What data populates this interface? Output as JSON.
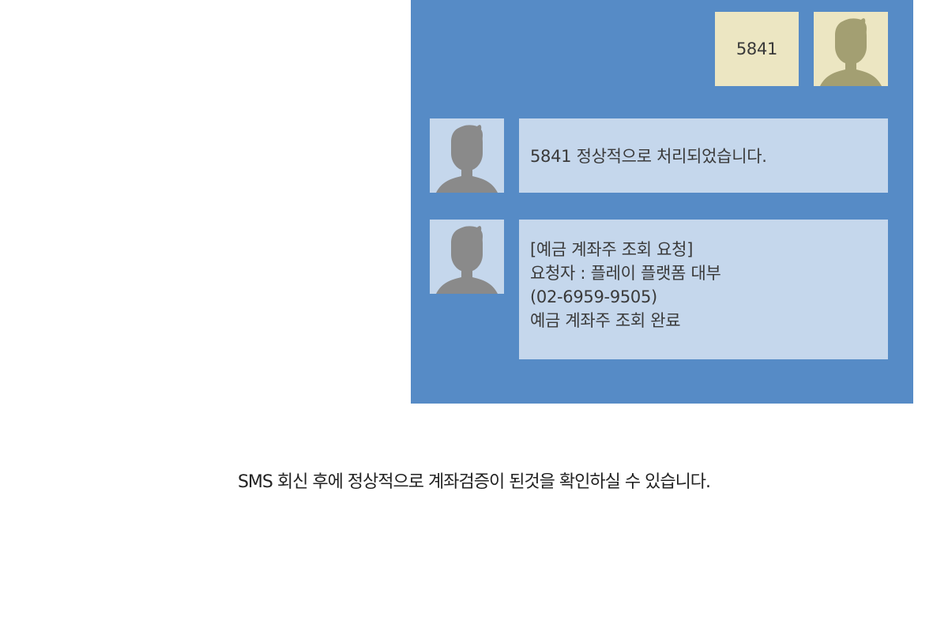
{
  "chat": {
    "sent_message": "5841",
    "reply_1": "5841 정상적으로 처리되었습니다.",
    "reply_2_lines": [
      "[예금 계좌주 조회 요청]",
      "요청자 : 플레이 플랫폼 대부",
      "(02-6959-9505)",
      "예금 계좌주 조회 완료"
    ]
  },
  "caption": "SMS 회신 후에 정상적으로 계좌검증이 된것을 확인하실 수 있습니다.",
  "colors": {
    "panel": "#568bc6",
    "sent_bubble": "#ece6c2",
    "received_bubble": "#c5d7ec",
    "sent_avatar_silhouette": "#a39f72",
    "received_avatar_silhouette": "#8a8a8a"
  },
  "icons": {
    "sender_avatar": "person-silhouette-icon",
    "receiver_avatar": "person-silhouette-icon"
  }
}
